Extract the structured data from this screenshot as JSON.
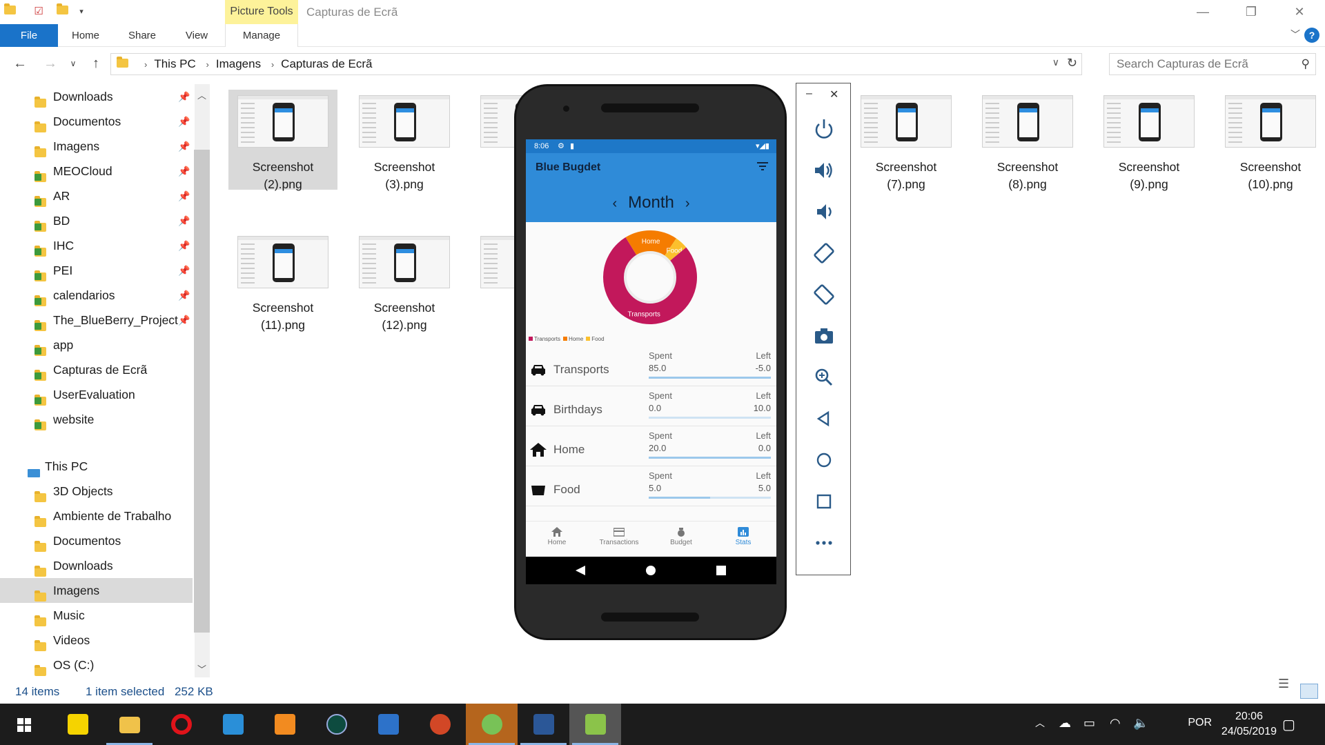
{
  "window": {
    "title": "Capturas de Ecrã",
    "context_tab": "Picture Tools",
    "minimize": "—",
    "maximize": "❐",
    "close": "✕"
  },
  "ribbon": {
    "tabs": [
      "File",
      "Home",
      "Share",
      "View",
      "Manage"
    ],
    "help": "?"
  },
  "address": {
    "crumbs": [
      "This PC",
      "Imagens",
      "Capturas de Ecrã"
    ],
    "search_placeholder": "Search Capturas de Ecrã"
  },
  "navpane": {
    "quick_access": [
      {
        "label": "Downloads",
        "pinned": true
      },
      {
        "label": "Documentos",
        "pinned": true
      },
      {
        "label": "Imagens",
        "pinned": true
      },
      {
        "label": "MEOCloud",
        "pinned": true
      },
      {
        "label": "AR",
        "pinned": true
      },
      {
        "label": "BD",
        "pinned": true
      },
      {
        "label": "IHC",
        "pinned": true
      },
      {
        "label": "PEI",
        "pinned": true
      },
      {
        "label": "calendarios",
        "pinned": true
      },
      {
        "label": "The_BlueBerry_Project",
        "pinned": true
      },
      {
        "label": "app",
        "pinned": false
      },
      {
        "label": "Capturas de Ecrã",
        "pinned": false
      },
      {
        "label": "UserEvaluation",
        "pinned": false
      },
      {
        "label": "website",
        "pinned": false
      }
    ],
    "this_pc": "This PC",
    "this_pc_items": [
      "3D Objects",
      "Ambiente de Trabalho",
      "Documentos",
      "Downloads",
      "Imagens",
      "Music",
      "Videos",
      "OS (C:)"
    ],
    "selected": "Imagens"
  },
  "files": [
    {
      "line1": "Screenshot",
      "line2": "(2).png",
      "selected": true
    },
    {
      "line1": "Screenshot",
      "line2": "(3).png"
    },
    {
      "line1": "Scr",
      "line2": "(4"
    },
    {
      "line1": "Screenshot",
      "line2": "(7).png"
    },
    {
      "line1": "Screenshot",
      "line2": "(8).png"
    },
    {
      "line1": "Screenshot",
      "line2": "(9).png"
    },
    {
      "line1": "Screenshot",
      "line2": "(10).png"
    },
    {
      "line1": "Screenshot",
      "line2": "(11).png"
    },
    {
      "line1": "Screenshot",
      "line2": "(12).png"
    },
    {
      "line1": "Scr",
      "line2": "(1"
    }
  ],
  "status": {
    "items": "14 items",
    "selected": "1 item selected",
    "size": "252 KB"
  },
  "taskbar": {
    "lang": "POR",
    "time": "20:06",
    "date": "24/05/2019"
  },
  "phone": {
    "status_time": "8:06",
    "app_title": "Blue Bugdet",
    "period": "Month",
    "prev": "‹",
    "next": "›",
    "legend": [
      "Transports",
      "Home",
      "Food"
    ],
    "colors": {
      "transports": "#c2185b",
      "home": "#f57c00",
      "food": "#fbc02d",
      "primary": "#2f8bd8"
    },
    "spent_label": "Spent",
    "left_label": "Left",
    "categories": [
      {
        "name": "Transports",
        "icon": "car-icon",
        "spent": "85.0",
        "left": "-5.0",
        "progress": 1.0
      },
      {
        "name": "Birthdays",
        "icon": "car-icon",
        "spent": "0.0",
        "left": "10.0",
        "progress": 0.0
      },
      {
        "name": "Home",
        "icon": "house-icon",
        "spent": "20.0",
        "left": "0.0",
        "progress": 1.0
      },
      {
        "name": "Food",
        "icon": "food-icon",
        "spent": "5.0",
        "left": "5.0",
        "progress": 0.5
      }
    ],
    "bottom_nav": [
      "Home",
      "Transactions",
      "Budget",
      "Stats"
    ],
    "active_nav": "Stats"
  },
  "chart_data": {
    "type": "pie",
    "categories": [
      "Transports",
      "Home",
      "Food"
    ],
    "values": [
      85,
      20,
      5
    ]
  }
}
